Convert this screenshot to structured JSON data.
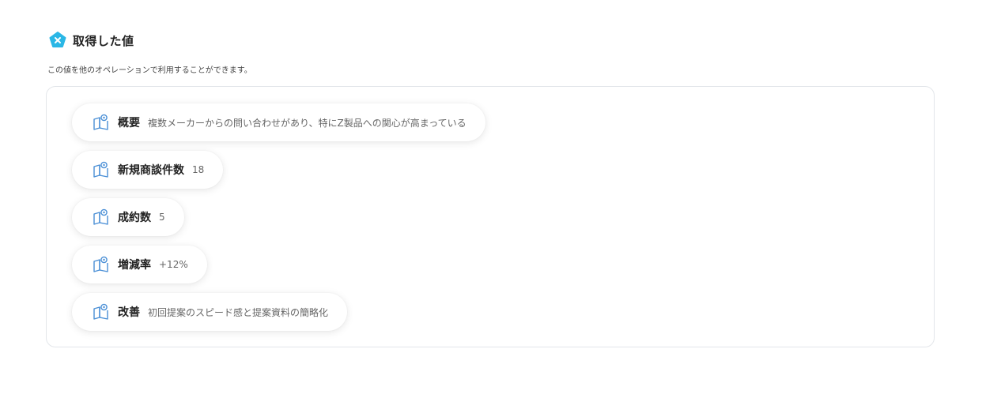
{
  "header": {
    "title": "取得した値",
    "icon": "x-variable-icon",
    "accent_color": "#2ab7e6"
  },
  "subtitle": "この値を他のオペレーションで利用することができます。",
  "items": [
    {
      "label": "概要",
      "value": "複数メーカーからの問い合わせがあり、特にZ製品への関心が高まっている",
      "icon": "book-pin-icon"
    },
    {
      "label": "新規商談件数",
      "value": "18",
      "icon": "book-pin-icon"
    },
    {
      "label": "成約数",
      "value": "5",
      "icon": "book-pin-icon"
    },
    {
      "label": "増減率",
      "value": "+12%",
      "icon": "book-pin-icon"
    },
    {
      "label": "改善",
      "value": "初回提案のスピード感と提案資料の簡略化",
      "icon": "book-pin-icon"
    }
  ]
}
